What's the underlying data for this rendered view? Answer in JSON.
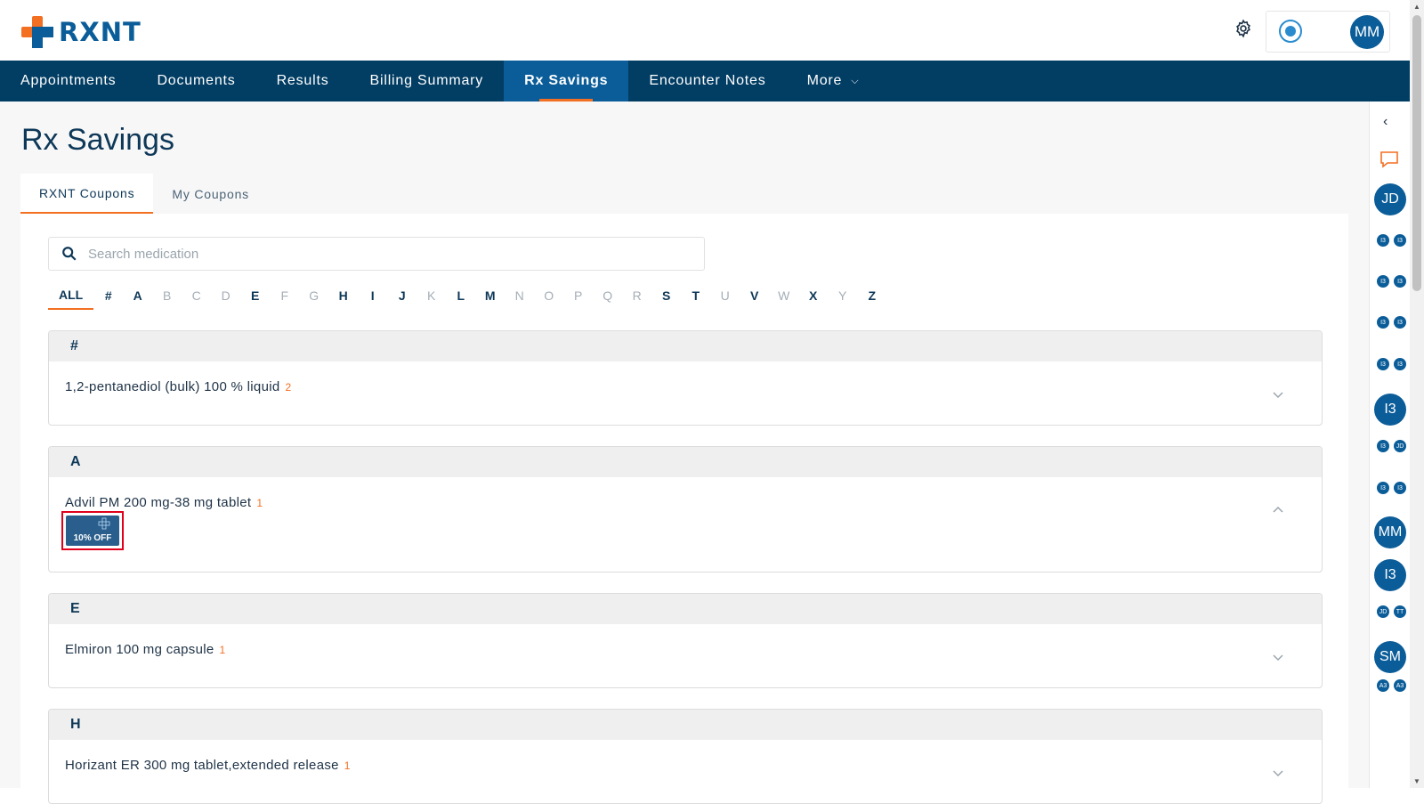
{
  "header": {
    "brand": "RXNT",
    "user_initials": "MM"
  },
  "nav": {
    "items": [
      {
        "label": "Appointments"
      },
      {
        "label": "Documents"
      },
      {
        "label": "Results"
      },
      {
        "label": "Billing Summary"
      },
      {
        "label": "Rx Savings"
      },
      {
        "label": "Encounter Notes"
      },
      {
        "label": "More"
      }
    ]
  },
  "page": {
    "title": "Rx Savings",
    "tabs": [
      {
        "label": "RXNT Coupons"
      },
      {
        "label": "My Coupons"
      }
    ],
    "search_placeholder": "Search medication",
    "alphabet": [
      "ALL",
      "#",
      "A",
      "B",
      "C",
      "D",
      "E",
      "F",
      "G",
      "H",
      "I",
      "J",
      "K",
      "L",
      "M",
      "N",
      "O",
      "P",
      "Q",
      "R",
      "S",
      "T",
      "U",
      "V",
      "W",
      "X",
      "Y",
      "Z"
    ]
  },
  "groups": [
    {
      "letter": "#",
      "items": [
        {
          "name": "1,2-pentanediol (bulk) 100 % liquid",
          "count": "2"
        }
      ]
    },
    {
      "letter": "A",
      "items": [
        {
          "name": "Advil PM 200 mg-38 mg tablet",
          "count": "1",
          "coupon": "10% OFF"
        }
      ]
    },
    {
      "letter": "E",
      "items": [
        {
          "name": "Elmiron 100 mg capsule",
          "count": "1"
        }
      ]
    },
    {
      "letter": "H",
      "items": [
        {
          "name": "Horizant ER 300 mg tablet,extended release",
          "count": "1"
        }
      ]
    }
  ],
  "rail": {
    "avatars": [
      "JD",
      "I3",
      "I3",
      "I3",
      "I3",
      "I3",
      "I3",
      "I3",
      "I3",
      "I3",
      "I3",
      "JD",
      "I3",
      "I3",
      "MM",
      "I3",
      "JD",
      "TT",
      "SM",
      "A3",
      "A3"
    ]
  },
  "colors": {
    "nav_bg": "#023d63",
    "nav_active": "#0b5d99",
    "accent": "#f36f21",
    "brand_blue": "#0b5d99"
  }
}
